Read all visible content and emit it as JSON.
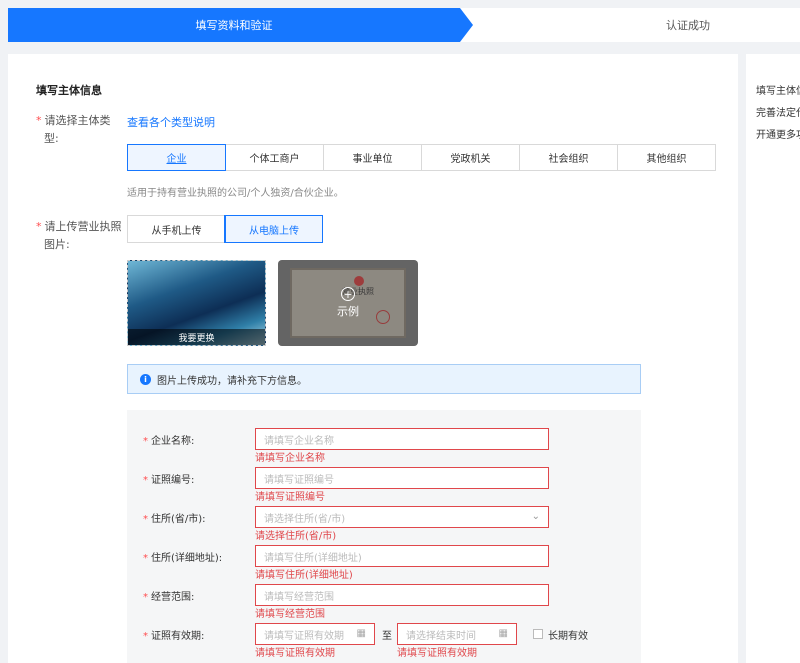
{
  "steps": {
    "current": "填写资料和验证",
    "next": "认证成功"
  },
  "side": {
    "lines": [
      "填写主体信",
      "完善法定代",
      "开通更多功"
    ]
  },
  "section_title": "填写主体信息",
  "subject_type": {
    "label": "请选择主体类型:",
    "label_line1": "请选择主体类",
    "label_line2": "型:",
    "link": "查看各个类型说明",
    "options": [
      "企业",
      "个体工商户",
      "事业单位",
      "党政机关",
      "社会组织",
      "其他组织"
    ],
    "selected": "企业",
    "hint": "适用于持有营业执照的公司/个人独资/合伙企业。"
  },
  "license": {
    "label_line1": "请上传营业执照",
    "label_line2": "图片:",
    "upload_options": [
      "从手机上传",
      "从电脑上传"
    ],
    "selected": "从电脑上传",
    "thumb_caption": "我要更换",
    "sample_label": "示例",
    "sample_doc_title": "营业执照"
  },
  "alert": {
    "text": "图片上传成功，请补充下方信息。",
    "icon": "info-icon"
  },
  "form": {
    "company_name": {
      "label": "企业名称:",
      "placeholder": "请填写企业名称",
      "error": "请填写企业名称"
    },
    "license_no": {
      "label": "证照编号:",
      "placeholder": "请填写证照编号",
      "error": "请填写证照编号"
    },
    "residence_region": {
      "label": "住所(省/市):",
      "placeholder": "请选择住所(省/市)",
      "error": "请选择住所(省/市)"
    },
    "residence_detail": {
      "label": "住所(详细地址):",
      "placeholder": "请填写住所(详细地址)",
      "error": "请填写住所(详细地址)"
    },
    "scope": {
      "label": "经营范围:",
      "placeholder": "请填写经营范围",
      "error": "请填写经营范围"
    },
    "validity": {
      "label": "证照有效期:",
      "start_placeholder": "请填写证照有效期",
      "separator": "至",
      "end_placeholder": "请选择结束时间",
      "long_term_label": "长期有效",
      "long_term_checked": false,
      "start_error": "请填写证照有效期",
      "end_error": "请填写证照有效期"
    }
  },
  "colors": {
    "primary": "#1677ff",
    "error": "#e0474b",
    "required": "#ff4d4f"
  }
}
